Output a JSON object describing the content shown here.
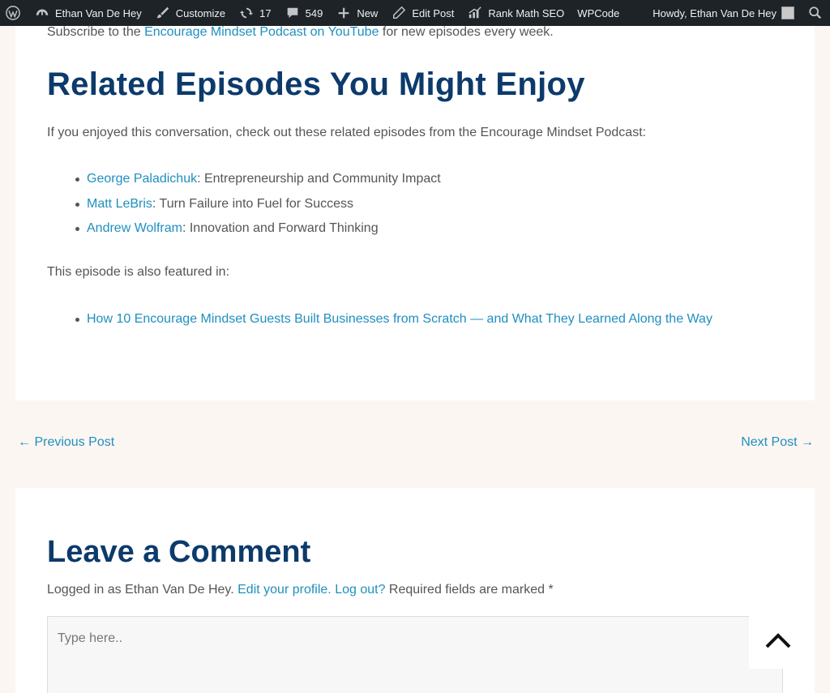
{
  "adminbar": {
    "site_name": "Ethan Van De Hey",
    "customize": "Customize",
    "updates_count": "17",
    "comments_count": "549",
    "new_label": "New",
    "edit_post": "Edit Post",
    "rank_math": "Rank Math SEO",
    "wpcode": "WPCode",
    "howdy": "Howdy, Ethan Van De Hey"
  },
  "intro": {
    "prefix": "Subscribe to the ",
    "link": "Encourage Mindset Podcast on YouTube",
    "suffix": " for new episodes every week."
  },
  "related": {
    "heading": "Related Episodes You Might Enjoy",
    "lead": "If you enjoyed this conversation, check out these related episodes from the Encourage Mindset Podcast:",
    "episodes": [
      {
        "name": "George Paladichuk",
        "desc": ": Entrepreneurship and Community Impact"
      },
      {
        "name": "Matt LeBris",
        "desc": ": Turn Failure into Fuel for Success"
      },
      {
        "name": "Andrew Wolfram",
        "desc": ": Innovation and Forward Thinking"
      }
    ],
    "featured_lead": "This episode is also featured in:",
    "featured_link": "How 10 Encourage Mindset Guests Built Businesses from Scratch — and What They Learned Along the Way"
  },
  "post_nav": {
    "previous": "← Previous Post",
    "next": "Next Post →"
  },
  "comment": {
    "heading": "Leave a Comment",
    "logged_prefix": "Logged in as Ethan Van De Hey. ",
    "edit_profile": "Edit your profile.",
    "log_out": "Log out?",
    "required_note": " Required fields are marked *",
    "placeholder": "Type here.."
  },
  "icons": {
    "wordpress": "wordpress-icon",
    "site": "dashboard-icon",
    "customize": "brush-icon",
    "updates": "refresh-icon",
    "comments": "comment-icon",
    "new": "plus-icon",
    "edit": "pencil-icon",
    "rank_math": "rank-math-icon",
    "search": "search-icon",
    "scroll_top": "chevron-up-icon"
  },
  "colors": {
    "heading": "#0c3a6b",
    "link": "#1f8fbf",
    "adminbar": "#1d2327",
    "page_bg": "#fcf6f3"
  }
}
